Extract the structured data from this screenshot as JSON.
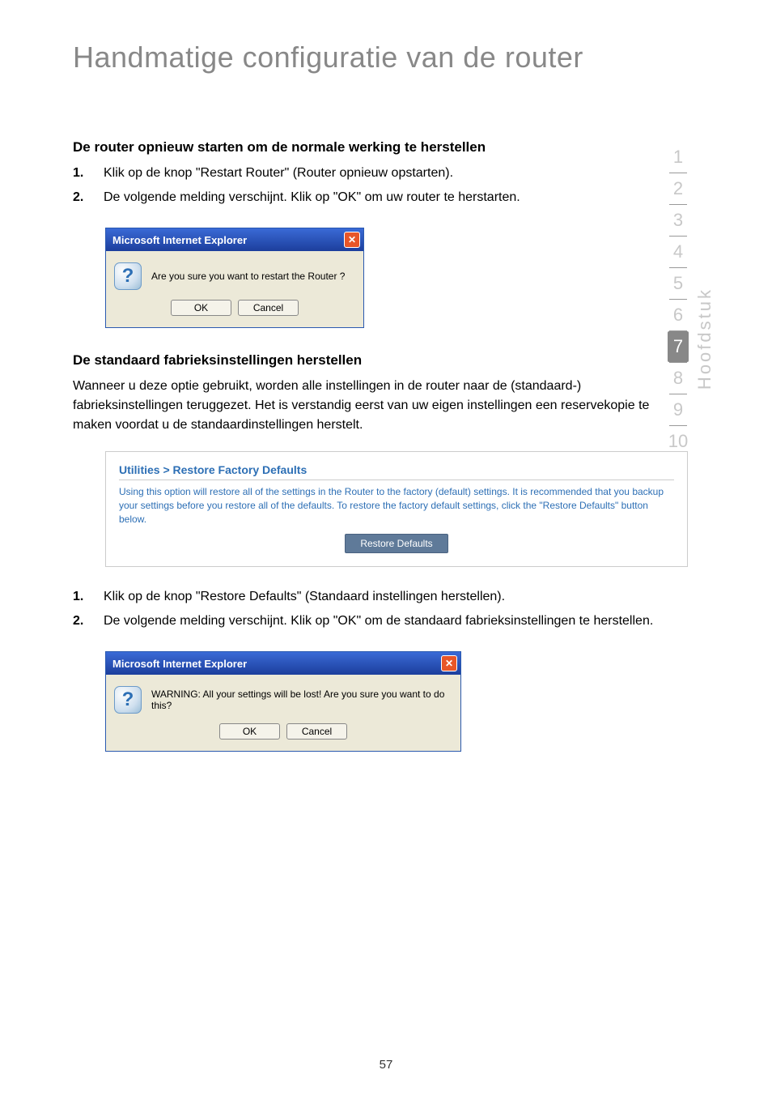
{
  "page": {
    "title": "Handmatige configuratie van de router",
    "number": "57"
  },
  "section1": {
    "title": "De router opnieuw starten om de normale werking te herstellen",
    "steps": [
      "Klik op de knop \"Restart Router\" (Router opnieuw opstarten).",
      "De volgende melding verschijnt. Klik op \"OK\" om uw router te herstarten."
    ]
  },
  "dialog1": {
    "title": "Microsoft Internet Explorer",
    "message": "Are you sure you want to restart the Router ?",
    "ok": "OK",
    "cancel": "Cancel",
    "close_symbol": "✕"
  },
  "section2": {
    "title": "De standaard fabrieksinstellingen herstellen",
    "paragraph": "Wanneer u deze optie gebruikt, worden alle instellingen in de router naar de (standaard-) fabrieksinstellingen teruggezet. Het is verstandig eerst van uw eigen instellingen een reservekopie te maken voordat u de standaardinstellingen herstelt."
  },
  "restore_panel": {
    "breadcrumb": "Utilities > Restore Factory Defaults",
    "desc": "Using this option will restore all of the settings in the Router to the factory (default) settings. It is recommended that you backup your settings before you restore all of the defaults. To restore the factory default settings, click the \"Restore Defaults\" button below.",
    "button": "Restore Defaults"
  },
  "section3": {
    "steps": [
      "Klik op de knop \"Restore Defaults\" (Standaard instellingen herstellen).",
      "De volgende melding verschijnt. Klik op \"OK\" om de standaard fabrieksinstellingen te herstellen."
    ]
  },
  "dialog2": {
    "title": "Microsoft Internet Explorer",
    "message": "WARNING: All your settings will be lost! Are you sure you want to do this?",
    "ok": "OK",
    "cancel": "Cancel",
    "close_symbol": "✕"
  },
  "sidenav": {
    "items": [
      "1",
      "2",
      "3",
      "4",
      "5",
      "6",
      "7",
      "8",
      "9",
      "10"
    ],
    "active_index": 6,
    "label": "Hoofdstuk"
  },
  "icons": {
    "question": "?"
  }
}
